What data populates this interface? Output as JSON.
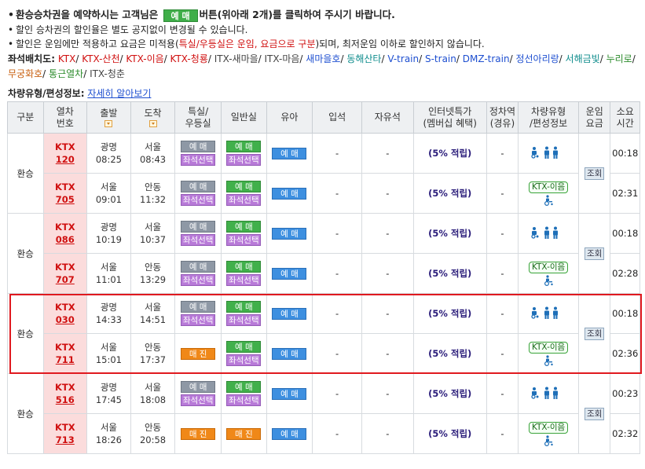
{
  "notice": {
    "line1_pre": "환승승차권을 예약하시는 고객님은",
    "line1_btn": "예 매",
    "line1_post": "버튼(위아래 2개)를 클릭하여 주시기 바랍니다.",
    "line2": "할인 승차권의 할인율은 별도 공지없이 변경될 수 있습니다.",
    "line3_pre": "할인은 운임에만 적용하고 요금은 미적용(",
    "line3_red": "특실/우등실은 운임, 요금으로 구분",
    "line3_post": ")되며, 최저운임 이하로 할인하지 않습니다."
  },
  "seat_layout": {
    "label": "좌석배치도:",
    "links": [
      {
        "text": "KTX",
        "color": "red"
      },
      {
        "text": "KTX-산천",
        "color": "red"
      },
      {
        "text": "KTX-이음",
        "color": "red"
      },
      {
        "text": "KTX-청룡",
        "color": "red"
      },
      {
        "text": "ITX-새마을",
        "color": "gray"
      },
      {
        "text": "ITX-마음",
        "color": "gray"
      },
      {
        "text": "새마을호",
        "color": "blue"
      },
      {
        "text": "동해산타",
        "color": "teal"
      },
      {
        "text": "V-train",
        "color": "blue"
      },
      {
        "text": "S-train",
        "color": "blue"
      },
      {
        "text": "DMZ-train",
        "color": "blue"
      },
      {
        "text": "정선아리랑",
        "color": "blue"
      },
      {
        "text": "서해금빛",
        "color": "teal"
      },
      {
        "text": "누리로",
        "color": "green"
      },
      {
        "text": "무궁화호",
        "color": "orange"
      },
      {
        "text": "통근열차",
        "color": "green"
      },
      {
        "text": "ITX-청춘",
        "color": "gray"
      }
    ]
  },
  "car_info": {
    "label": "차량유형/편성정보:",
    "link": "자세히 알아보기"
  },
  "headers": {
    "division": "구분",
    "train_no_1": "열차",
    "train_no_2": "번호",
    "depart": "출발",
    "arrive": "도착",
    "special_1": "특실/",
    "special_2": "우등실",
    "general": "일반실",
    "infant": "유아",
    "standing": "입석",
    "free": "자유석",
    "internet_1": "인터넷특가",
    "internet_2": "(멤버십 혜택)",
    "stop_1": "정차역",
    "stop_2": "(경유)",
    "cartype_1": "차량유형",
    "cartype_2": "/편성정보",
    "fare_1": "운임",
    "fare_2": "요금",
    "duration_1": "소요",
    "duration_2": "시간"
  },
  "labels": {
    "reserve": "예 매",
    "soldout": "매 진",
    "seat_select": "좌석선택",
    "discount": "(5% 적립)",
    "dash": "-",
    "transfer": "환승",
    "lookup": "조회",
    "ktx_eum": "KTX-이음"
  },
  "groups": [
    {
      "rows": [
        {
          "train": "KTX",
          "no": "120",
          "from": "광명",
          "dep": "08:25",
          "to": "서울",
          "arr": "08:43",
          "special": "reserve",
          "general": "reserve",
          "type": "icons",
          "duration": "00:18"
        },
        {
          "train": "KTX",
          "no": "705",
          "from": "서울",
          "dep": "09:01",
          "to": "안동",
          "arr": "11:32",
          "special": "reserve",
          "general": "reserve",
          "type": "eum",
          "duration": "02:31"
        }
      ]
    },
    {
      "rows": [
        {
          "train": "KTX",
          "no": "086",
          "from": "광명",
          "dep": "10:19",
          "to": "서울",
          "arr": "10:37",
          "special": "reserve",
          "general": "reserve",
          "type": "icons",
          "duration": "00:18"
        },
        {
          "train": "KTX",
          "no": "707",
          "from": "서울",
          "dep": "11:01",
          "to": "안동",
          "arr": "13:29",
          "special": "reserve",
          "general": "reserve",
          "type": "eum",
          "duration": "02:28"
        }
      ]
    },
    {
      "rows": [
        {
          "train": "KTX",
          "no": "030",
          "from": "광명",
          "dep": "14:33",
          "to": "서울",
          "arr": "14:51",
          "special": "reserve",
          "general": "reserve",
          "type": "icons",
          "duration": "00:18"
        },
        {
          "train": "KTX",
          "no": "711",
          "from": "서울",
          "dep": "15:01",
          "to": "안동",
          "arr": "17:37",
          "special": "soldout",
          "general": "reserve",
          "type": "eum",
          "duration": "02:36"
        }
      ]
    },
    {
      "rows": [
        {
          "train": "KTX",
          "no": "516",
          "from": "광명",
          "dep": "17:45",
          "to": "서울",
          "arr": "18:08",
          "special": "reserve",
          "general": "reserve",
          "type": "icons",
          "duration": "00:23"
        },
        {
          "train": "KTX",
          "no": "713",
          "from": "서울",
          "dep": "18:26",
          "to": "안동",
          "arr": "20:58",
          "special": "soldout",
          "general": "soldout",
          "type": "eum",
          "duration": "02:32"
        }
      ]
    }
  ]
}
